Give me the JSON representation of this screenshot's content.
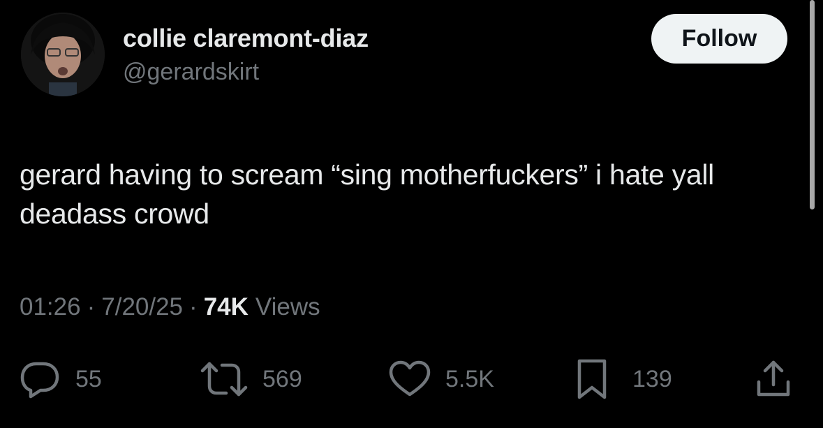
{
  "author": {
    "display_name": "collie claremont-diaz",
    "handle": "@gerardskirt"
  },
  "follow_label": "Follow",
  "tweet": {
    "text": "gerard having to scream “sing motherfuckers” i hate yall deadass crowd"
  },
  "meta": {
    "time": "01:26",
    "separator": "·",
    "date": "7/20/25",
    "views_count": "74K",
    "views_label": "Views"
  },
  "actions": {
    "replies": "55",
    "reposts": "569",
    "likes": "5.5K",
    "bookmarks": "139"
  },
  "icons": {
    "reply": "reply-icon",
    "repost": "repost-icon",
    "like": "heart-icon",
    "bookmark": "bookmark-icon",
    "share": "share-icon"
  },
  "colors": {
    "background": "#000000",
    "primary_text": "#e7e9ea",
    "secondary_text": "#71767b",
    "follow_bg": "#eff3f4"
  }
}
